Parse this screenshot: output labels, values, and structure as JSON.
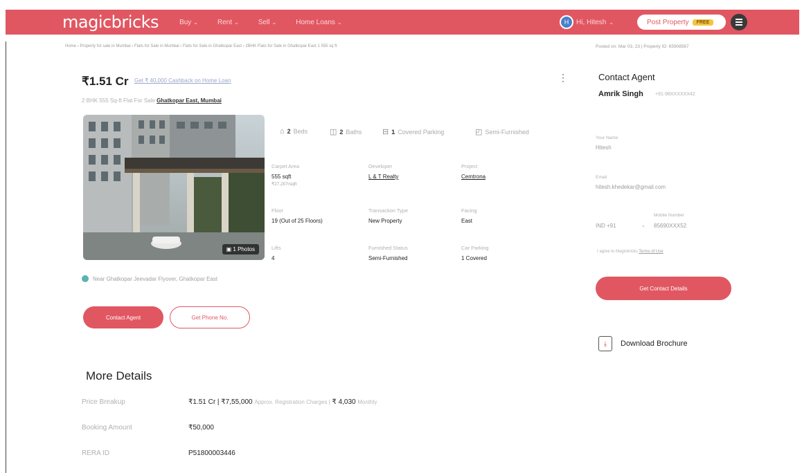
{
  "header": {
    "logo": "magicbricks",
    "nav": [
      "Buy",
      "Rent",
      "Sell",
      "Home Loans"
    ],
    "user_initial": "H",
    "user_name": "Hi, Hitesh",
    "post_property": "Post Property",
    "post_badge": "FREE"
  },
  "breadcrumb": "Home › Property for sale in Mumbai › Flats for Sale in Mumbai › Flats for Sale in Ghatkopar East › 2BHK Flats for Sale in Ghatkopar East 1 555 sq ft",
  "posted_info": "Posted on: Mar 03, 23  |  Property ID: 65908567",
  "listing": {
    "price": "₹1.51 Cr",
    "cashback": "Get ₹ 40,000 Cashback on Home Loan",
    "subtitle_prefix": "2 BHK 555 Sq-ft Flat For Sale",
    "location": "Ghatkopar East, Mumbai",
    "photo_count": "1 Photos",
    "amenities": [
      {
        "icon": "bed-icon",
        "value": "2",
        "label": "Beds"
      },
      {
        "icon": "bath-icon",
        "value": "2",
        "label": "Baths"
      },
      {
        "icon": "parking-icon",
        "value": "1",
        "label": "Covered Parking"
      },
      {
        "icon": "furnish-icon",
        "value": "",
        "label": "Semi-Furnished"
      }
    ],
    "specs": [
      {
        "label": "Carpet Area",
        "value": "555 sqft",
        "sub": "₹27,207/sqft"
      },
      {
        "label": "Developer",
        "value": "L & T Realty",
        "sub": ""
      },
      {
        "label": "Project",
        "value": "Cemtrona",
        "sub": ""
      },
      {
        "label": "Floor",
        "value": "19 (Out of 25 Floors)",
        "sub": ""
      },
      {
        "label": "Transaction Type",
        "value": "New Property",
        "sub": ""
      },
      {
        "label": "Facing",
        "value": "East",
        "sub": ""
      },
      {
        "label": "Lifts",
        "value": "4",
        "sub": ""
      },
      {
        "label": "Furnished Status",
        "value": "Semi-Furnished",
        "sub": ""
      },
      {
        "label": "Car Parking",
        "value": "1 Covered",
        "sub": ""
      }
    ],
    "nearby": "Near Ghatkopar Jeevadar Flyover, Ghatkopar East",
    "contact_btn": "Contact Agent",
    "phone_btn": "Get Phone No."
  },
  "more_details": {
    "title": "More Details",
    "rows": [
      {
        "label": "Price Breakup",
        "value": "₹1.51 Cr | ₹7,55,000",
        "muted": "Approx. Registration Charges |",
        "value2": "₹ 4,030",
        "muted2": "Monthly"
      },
      {
        "label": "Booking Amount",
        "value": "₹50,000",
        "muted": "",
        "value2": "",
        "muted2": ""
      },
      {
        "label": "RERA ID",
        "value": "P51800003446",
        "muted": "",
        "value2": "",
        "muted2": ""
      }
    ]
  },
  "contact": {
    "title": "Contact Agent",
    "agent_name": "Amrik Singh",
    "agent_phone": "+91-98XXXXXX42",
    "name_label": "Your Name",
    "name_value": "Hitesh",
    "email_label": "Email",
    "email_value": "hitesh.khedekar@gmail.com",
    "mobile_label": "Mobile Number",
    "country_code": "IND +91",
    "mobile_value": "85690XXX52",
    "terms_text": "I agree to Magicbricks",
    "terms_link": "Terms of Use",
    "details_btn": "Get Contact Details",
    "brochure": "Download Brochure"
  },
  "colors": {
    "brand": "#e05762",
    "text": "#222222",
    "muted": "#b0b0b0"
  }
}
